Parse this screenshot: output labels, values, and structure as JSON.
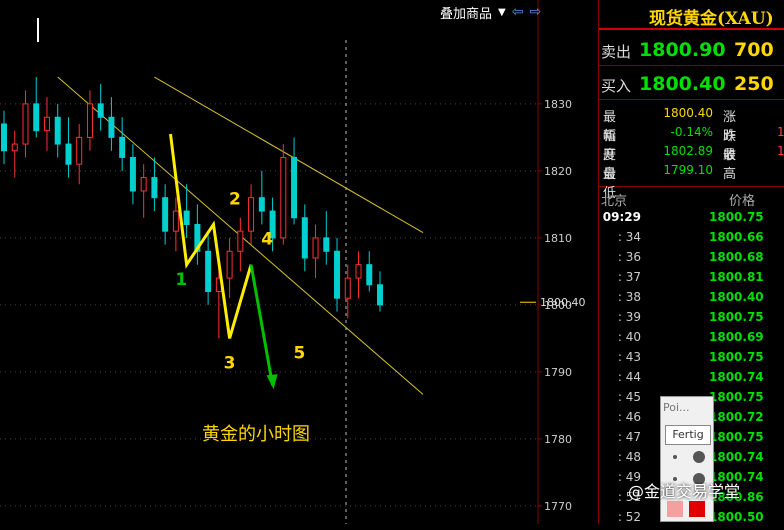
{
  "toolbar": {
    "overlay_label": "叠加商品",
    "dropdown_icon": "▼",
    "back_icon": "⇦",
    "forward_icon": "⇨"
  },
  "panel": {
    "title": "现货黄金(XAU)",
    "sell": {
      "label": "卖出",
      "price": "1800.90",
      "volume": "700"
    },
    "buy": {
      "label": "买入",
      "price": "1800.40",
      "volume": "250"
    },
    "stats": [
      {
        "k": "最新",
        "v": "1800.40",
        "v_color": "#ffd700",
        "k2": "涨跌",
        "v2": ""
      },
      {
        "k": "幅度",
        "v": "-0.14%",
        "v_color": "#00e000",
        "k2": "昨收",
        "v2": "1"
      },
      {
        "k": "开盘",
        "v": "1802.89",
        "v_color": "#00e000",
        "k2": "最高",
        "v2": "1"
      },
      {
        "k": "最低",
        "v": "1799.10",
        "v_color": "#00e000",
        "k2": "",
        "v2": ""
      }
    ],
    "ticks_header": {
      "left": "北京",
      "right": "价格"
    },
    "ticks": [
      {
        "t": "09:29",
        "p": "1800.75"
      },
      {
        "t": ": 34",
        "p": "1800.66"
      },
      {
        "t": ": 36",
        "p": "1800.68"
      },
      {
        "t": ": 37",
        "p": "1800.81"
      },
      {
        "t": ": 38",
        "p": "1800.40"
      },
      {
        "t": ": 39",
        "p": "1800.75"
      },
      {
        "t": ": 40",
        "p": "1800.69"
      },
      {
        "t": ": 43",
        "p": "1800.75"
      },
      {
        "t": ": 44",
        "p": "1800.74"
      },
      {
        "t": ": 45",
        "p": "1800.75"
      },
      {
        "t": ": 46",
        "p": "1800.72"
      },
      {
        "t": ": 47",
        "p": "1800.75"
      },
      {
        "t": ": 48",
        "p": "1800.74"
      },
      {
        "t": ": 49",
        "p": "1800.74"
      },
      {
        "t": ": 51",
        "p": "1800.86"
      },
      {
        "t": ": 52",
        "p": "1800.50"
      }
    ]
  },
  "popup": {
    "header": "Poi...",
    "button": "Fertig"
  },
  "watermark": "@金道交易学堂",
  "chart_data": {
    "type": "candlestick",
    "title": "黄金的小时图",
    "y_ticks": [
      1770,
      1780,
      1790,
      1800,
      1810,
      1820,
      1830
    ],
    "ylim": [
      1767.3,
      1845.5
    ],
    "current_price": "1800.40",
    "candles": [
      [
        1827,
        1829,
        1821,
        1823
      ],
      [
        1823,
        1826,
        1819,
        1824
      ],
      [
        1824,
        1832,
        1822,
        1830
      ],
      [
        1830,
        1834,
        1825,
        1826
      ],
      [
        1826,
        1831,
        1823,
        1828
      ],
      [
        1828,
        1830,
        1822,
        1824
      ],
      [
        1824,
        1828,
        1819,
        1821
      ],
      [
        1821,
        1827,
        1818,
        1825
      ],
      [
        1825,
        1832,
        1823,
        1830
      ],
      [
        1830,
        1833,
        1826,
        1828
      ],
      [
        1828,
        1831,
        1823,
        1825
      ],
      [
        1825,
        1828,
        1820,
        1822
      ],
      [
        1822,
        1824,
        1815,
        1817
      ],
      [
        1817,
        1821,
        1813,
        1819
      ],
      [
        1819,
        1822,
        1814,
        1816
      ],
      [
        1816,
        1818,
        1809,
        1811
      ],
      [
        1811,
        1816,
        1808,
        1814
      ],
      [
        1814,
        1818,
        1810,
        1812
      ],
      [
        1812,
        1815,
        1806,
        1808
      ],
      [
        1808,
        1811,
        1800,
        1802
      ],
      [
        1802,
        1806,
        1795,
        1804
      ],
      [
        1804,
        1810,
        1801,
        1808
      ],
      [
        1808,
        1813,
        1805,
        1811
      ],
      [
        1811,
        1818,
        1809,
        1816
      ],
      [
        1816,
        1820,
        1812,
        1814
      ],
      [
        1814,
        1816,
        1808,
        1810
      ],
      [
        1810,
        1824,
        1809,
        1822
      ],
      [
        1822,
        1825,
        1812,
        1813
      ],
      [
        1813,
        1815,
        1805,
        1807
      ],
      [
        1807,
        1812,
        1804,
        1810
      ],
      [
        1810,
        1814,
        1806,
        1808
      ],
      [
        1808,
        1810,
        1799,
        1801
      ],
      [
        1801,
        1806,
        1798,
        1804
      ],
      [
        1804,
        1808,
        1801,
        1806
      ],
      [
        1806,
        1808,
        1802,
        1803
      ],
      [
        1803,
        1805,
        1799,
        1800
      ]
    ],
    "waves": [
      {
        "label": "1",
        "color": "#00c000",
        "x_index": 16.5,
        "y": 1803
      },
      {
        "label": "2",
        "color": "#ffd700",
        "x_index": 21.5,
        "y": 1815
      },
      {
        "label": "3",
        "color": "#ffd700",
        "x_index": 21.0,
        "y": 1790.5
      },
      {
        "label": "4",
        "color": "#ffd700",
        "x_index": 24.5,
        "y": 1809
      },
      {
        "label": "5",
        "color": "#ffd700",
        "x_index": 27.5,
        "y": 1792
      }
    ],
    "wave_path": [
      [
        15.5,
        1825.5
      ],
      [
        17.0,
        1806
      ],
      [
        19.5,
        1812
      ],
      [
        21.0,
        1795
      ],
      [
        23.0,
        1806
      ]
    ],
    "projection": [
      [
        23.0,
        1806
      ],
      [
        25.0,
        1788
      ]
    ],
    "channel": {
      "upper": [
        [
          5,
          1834
        ],
        [
          33,
          1808
        ]
      ],
      "lower": [
        [
          5,
          1834
        ],
        [
          33,
          1795
        ]
      ]
    }
  }
}
